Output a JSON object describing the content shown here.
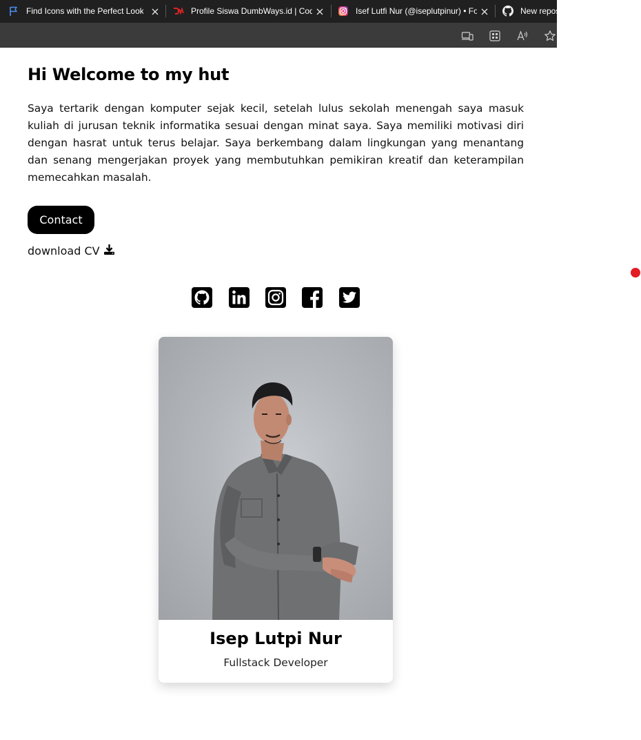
{
  "browser": {
    "tabs": [
      {
        "title": "Find Icons with the Perfect Look & Feel",
        "icon": "flag-icon"
      },
      {
        "title": "Profile Siswa DumbWays.id | Coding Bootcamp",
        "icon": "dumbways-icon"
      },
      {
        "title": "Isef Lutfi Nur (@iseplutpinur) • Foto dan video Instagram",
        "icon": "instagram-icon"
      },
      {
        "title": "New repository",
        "icon": "github-icon"
      }
    ],
    "toolbar_icons": [
      "devices-icon",
      "apps-icon",
      "read-aloud-icon",
      "favorite-star-icon"
    ]
  },
  "hero": {
    "heading": "Hi Welcome to my hut",
    "paragraph": "Saya tertarik dengan komputer sejak kecil, setelah lulus sekolah menengah saya masuk kuliah di jurusan teknik informatika sesuai dengan minat saya. Saya memiliki motivasi diri dengan hasrat untuk terus belajar. Saya berkembang dalam lingkungan yang menantang dan senang mengerjakan proyek yang membutuhkan pemikiran kreatif dan keterampilan memecahkan masalah.",
    "contact_label": "Contact",
    "download_label": "download CV"
  },
  "social": [
    "github-icon",
    "linkedin-icon",
    "instagram-icon",
    "facebook-icon",
    "twitter-icon"
  ],
  "profile": {
    "name": "Isep Lutpi Nur",
    "role": "Fullstack Developer"
  },
  "colors": {
    "tabstrip": "#202020",
    "toolbar": "#3b3b3b",
    "button": "#000000",
    "accent_dot": "#e31b23"
  }
}
